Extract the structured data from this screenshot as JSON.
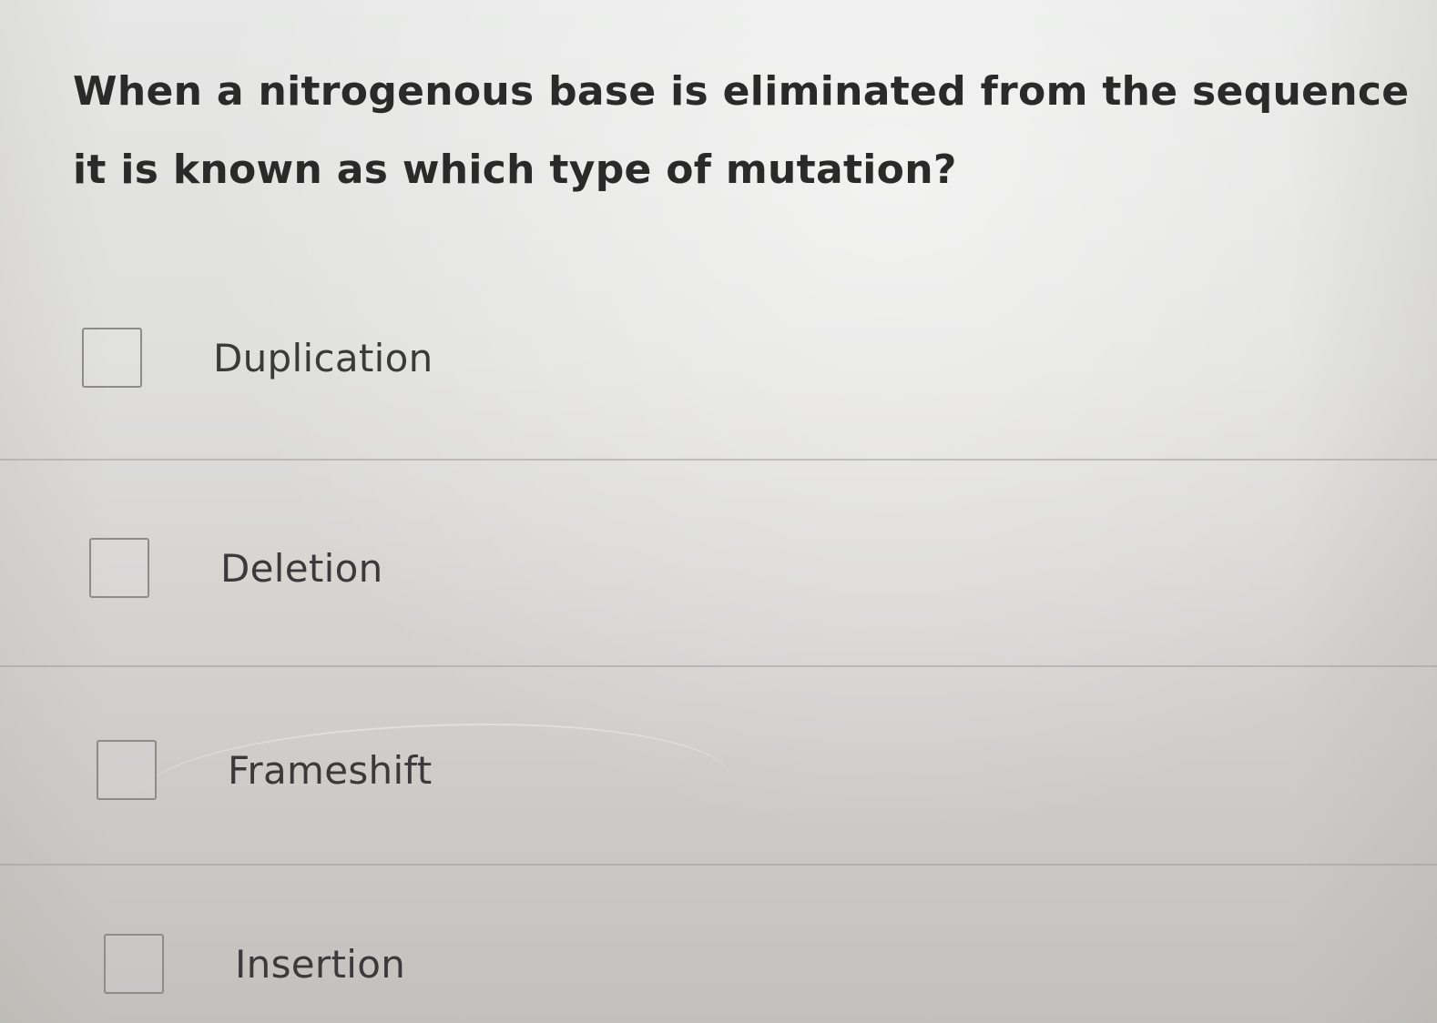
{
  "question": {
    "line1": "When a nitrogenous base is eliminated from the sequence",
    "line2": "it is known as which type of mutation?"
  },
  "options": [
    {
      "label": "Duplication",
      "checked": false
    },
    {
      "label": "Deletion",
      "checked": false
    },
    {
      "label": "Frameshift",
      "checked": false
    },
    {
      "label": "Insertion",
      "checked": false
    }
  ]
}
